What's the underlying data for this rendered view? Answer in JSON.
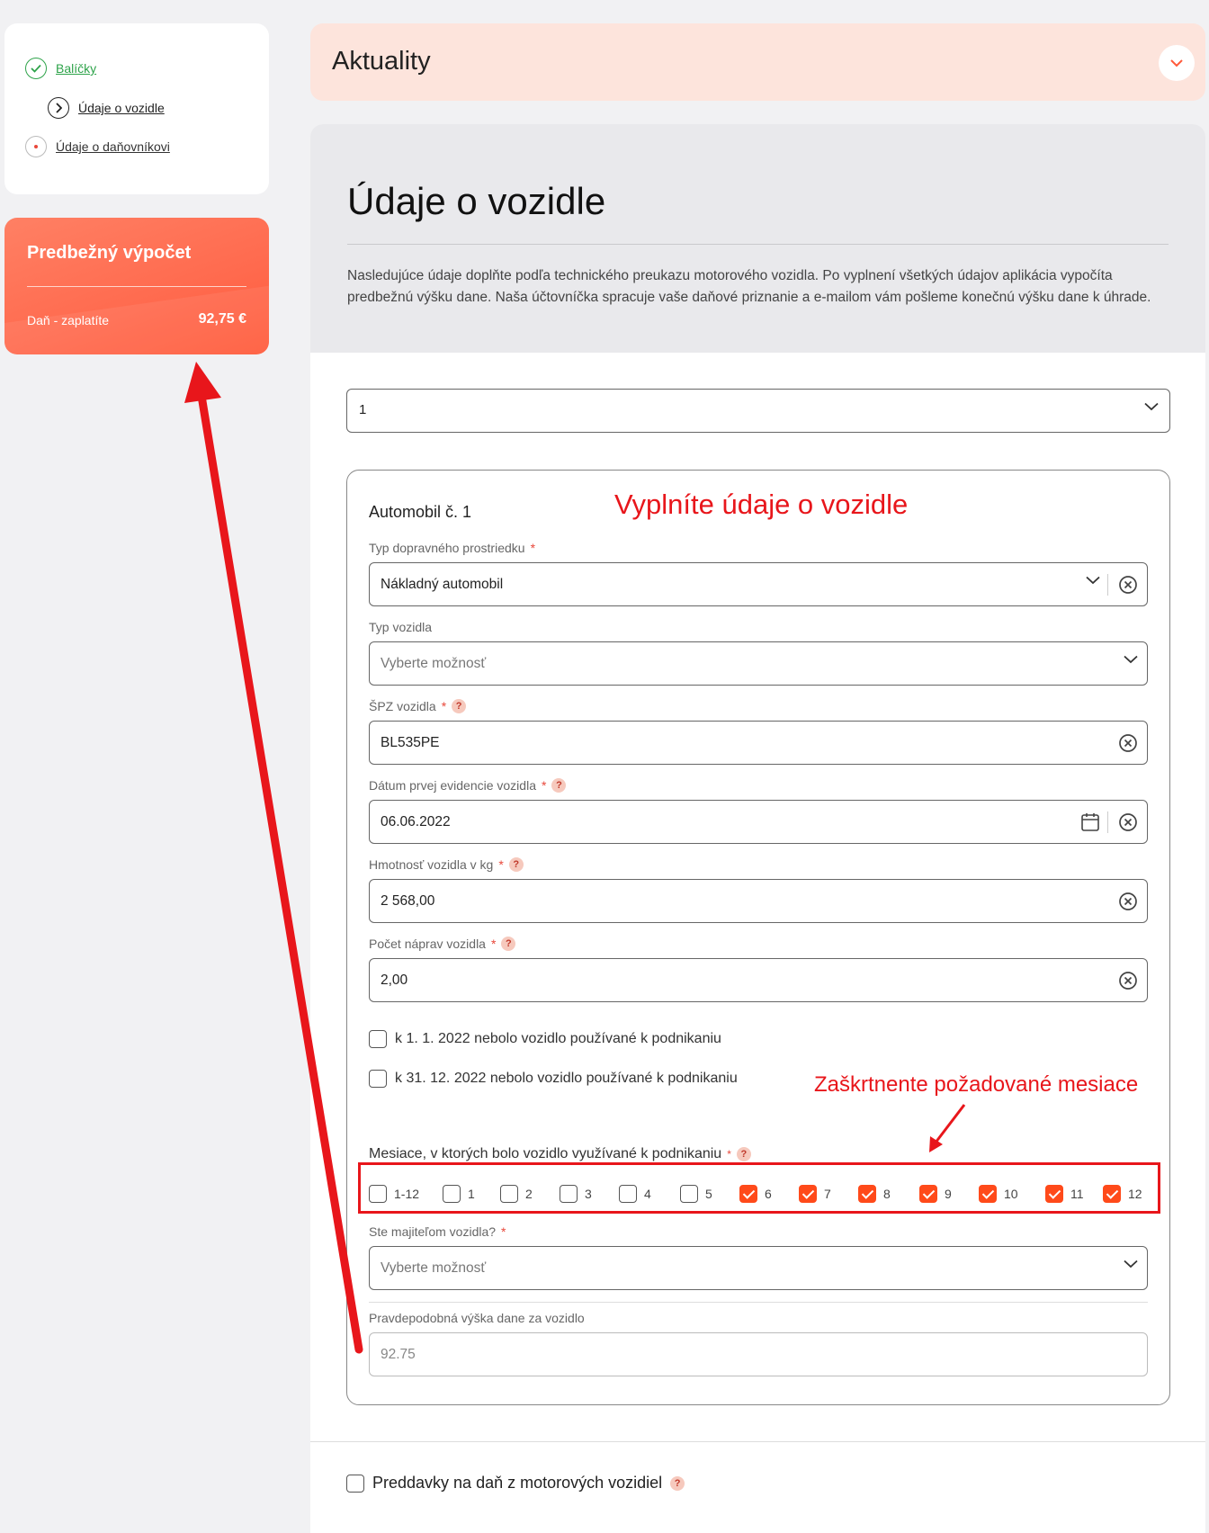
{
  "sidebar": {
    "steps": [
      {
        "label": "Balíčky",
        "state": "done"
      },
      {
        "label": "Údaje o vozidle",
        "state": "current"
      },
      {
        "label": "Údaje o daňovníkovi",
        "state": "pending"
      }
    ]
  },
  "calc": {
    "title": "Predbežný výpočet",
    "tax_label": "Daň - zaplatíte",
    "tax_value": "92,75 €"
  },
  "news": {
    "title": "Aktuality"
  },
  "main": {
    "title": "Údaje o vozidle",
    "description": "Nasledujúce údaje doplňte podľa technického preukazu motorového vozidla. Po vyplnení všetkých údajov aplikácia vypočíta predbežnú výšku dane. Naša účtovníčka spracuje vaše daňové priznanie a e-mailom vám pošleme konečnú výšku dane k úhrade.",
    "vehicle_count": "1"
  },
  "vehicle": {
    "title": "Automobil č. 1",
    "fields": {
      "transport_type": {
        "label": "Typ dopravného prostriedku",
        "value": "Nákladný automobil"
      },
      "vehicle_type": {
        "label": "Typ vozidla",
        "placeholder": "Vyberte možnosť"
      },
      "plate": {
        "label": "ŠPZ vozidla",
        "value": "BL535PE"
      },
      "first_registration": {
        "label": "Dátum prvej evidencie vozidla",
        "value": "06.06.2022"
      },
      "weight": {
        "label": "Hmotnosť vozidla v kg",
        "value": "2 568,00"
      },
      "axles": {
        "label": "Počet náprav vozidla",
        "value": "2,00"
      },
      "owner": {
        "label": "Ste majiteľom vozidla?",
        "placeholder": "Vyberte možnosť"
      },
      "estimated_tax": {
        "label": "Pravdepodobná výška dane za vozidlo",
        "value": "92.75"
      }
    },
    "checks": {
      "start_of_year": "k 1. 1. 2022 nebolo vozidlo používané k podnikaniu",
      "end_of_year": "k 31. 12. 2022 nebolo vozidlo používané k podnikaniu"
    },
    "months_label": "Mesiace, v ktorých bolo vozidlo využívané k podnikaniu",
    "months": [
      {
        "label": "1-12",
        "checked": false
      },
      {
        "label": "1",
        "checked": false
      },
      {
        "label": "2",
        "checked": false
      },
      {
        "label": "3",
        "checked": false
      },
      {
        "label": "4",
        "checked": false
      },
      {
        "label": "5",
        "checked": false
      },
      {
        "label": "6",
        "checked": true
      },
      {
        "label": "7",
        "checked": true
      },
      {
        "label": "8",
        "checked": true
      },
      {
        "label": "9",
        "checked": true
      },
      {
        "label": "10",
        "checked": true
      },
      {
        "label": "11",
        "checked": true
      },
      {
        "label": "12",
        "checked": true
      }
    ]
  },
  "advance": {
    "label": "Preddavky na daň z motorových vozidiel"
  },
  "annotations": {
    "fill_vehicle": "Vyplníte údaje o vozidle",
    "check_months": "Zaškrtnente požadované mesiace"
  },
  "colors": {
    "accent": "#ff4a1a",
    "annotation": "#e8161b",
    "success": "#2ea34a"
  }
}
